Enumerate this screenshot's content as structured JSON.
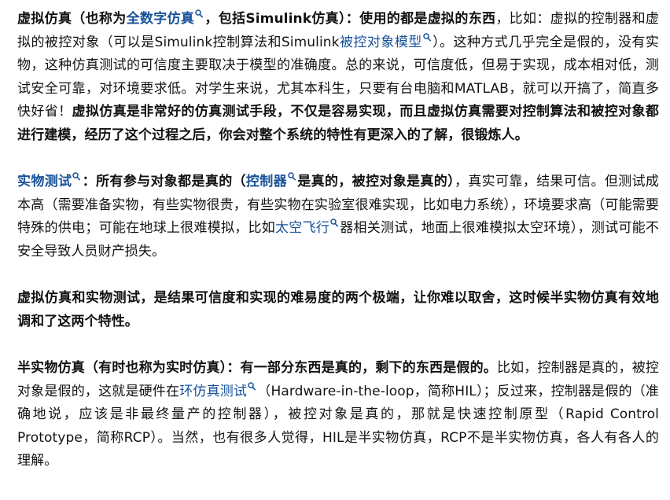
{
  "p1": {
    "s1": "虚拟仿真（也称为",
    "link1": "全数字仿真",
    "s2": "，包括Simulink仿真）：使用的都是虚拟的东西",
    "s3": "，比如：虚拟的控制器和虚拟的被控对象（可以是Simulink控制算法和Simulink",
    "link2": "被控对象模型",
    "s4": "）。这种方式几乎完全是假的，没有实物，这种仿真测试的可信度主要取决于模型的准确度。总的来说，可信度低，但易于实现，成本相对低，测试安全可靠，对环境要求低。对学生来说，尤其本科生，只要有台电脑和MATLAB，就可以开搞了，简直多快好省！",
    "s5": "虚拟仿真是非常好的仿真测试手段，不仅是容易实现，而且虚拟仿真需要对控制算法和被控对象都进行建模，经历了这个过程之后，你会对整个系统的特性有更深入的了解，很锻炼人。"
  },
  "p2": {
    "link1": "实物测试",
    "s1": "：所有参与对象都是真的（",
    "link2": "控制器",
    "s2": "是真的，被控对象是真的）",
    "s3": "，真实可靠，结果可信。但测试成本高（需要准备实物，有些实物很贵，有些实物在实验室很难实现，比如电力系统），环境要求高（可能需要特殊的供电；可能在地球上很难模拟，比如",
    "link3": "太空飞行",
    "s4": "器相关测试，地面上很难模拟太空环境），测试可能不安全导致人员财产损失。"
  },
  "p3": {
    "s1": "虚拟仿真和实物测试，是结果可信度和实现的难易度的两个极端，让你难以取舍，这时候半实物仿真有效地调和了这两个特性。"
  },
  "p4": {
    "s1": "半实物仿真（有时也称为实时仿真）：有一部分东西是真的，剩下的东西是假的。",
    "s2": "比如，控制器是真的，被控对象是假的，这就是硬件在",
    "link1": "环仿真测试",
    "s3": "（Hardware-in-the-loop，简称HIL）；反过来，控制器是假的（准确地说，应该是非最终量产的控制器），被控对象是真的，那就是快速控制原型（Rapid Control Prototype，简称RCP）。当然，也有很多人觉得，HIL是半实物仿真，RCP不是半实物仿真，各人有各人的理解。"
  },
  "colors": {
    "text": "#121212",
    "link": "#175199"
  },
  "icons": {
    "link_marker": "search-icon"
  }
}
